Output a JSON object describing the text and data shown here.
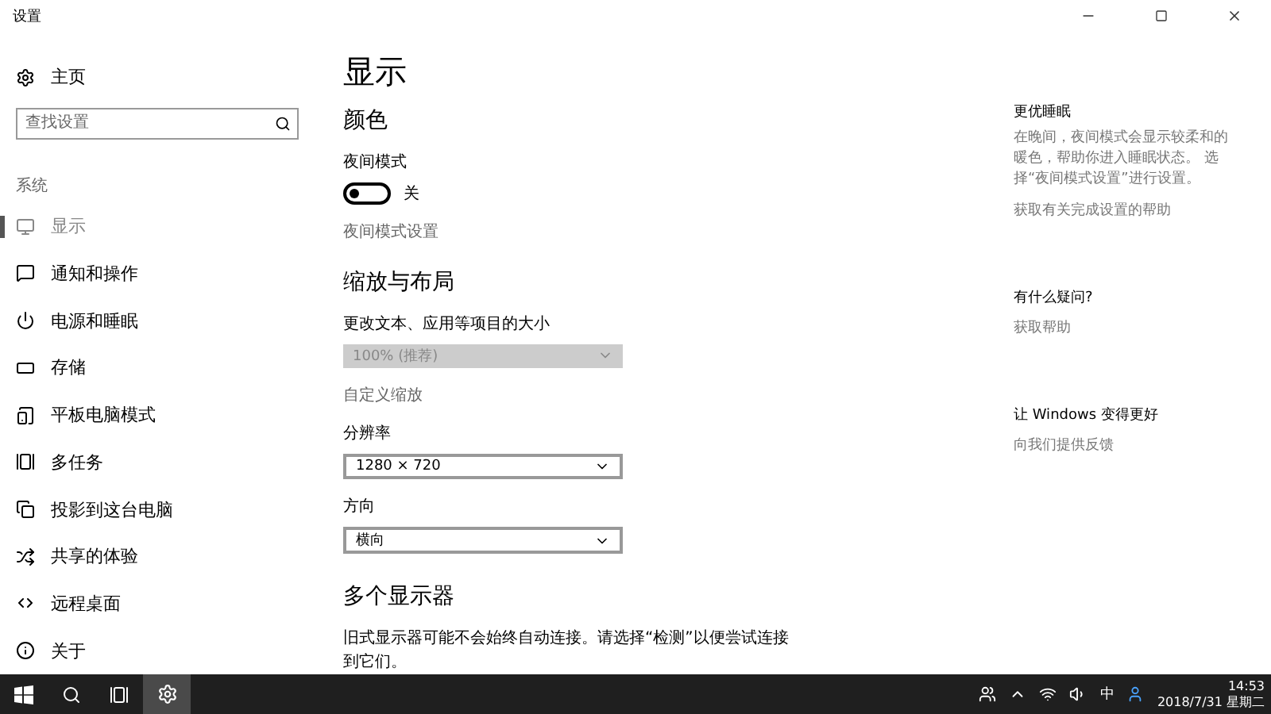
{
  "window": {
    "title": "设置"
  },
  "sidebar": {
    "home": "主页",
    "search": {
      "placeholder": "查找设置"
    },
    "section": "系统",
    "items": [
      {
        "label": "显示",
        "selected": true
      },
      {
        "label": "通知和操作",
        "selected": false
      },
      {
        "label": "电源和睡眠",
        "selected": false
      },
      {
        "label": "存储",
        "selected": false
      },
      {
        "label": "平板电脑模式",
        "selected": false
      },
      {
        "label": "多任务",
        "selected": false
      },
      {
        "label": "投影到这台电脑",
        "selected": false
      },
      {
        "label": "共享的体验",
        "selected": false
      },
      {
        "label": "远程桌面",
        "selected": false
      },
      {
        "label": "关于",
        "selected": false
      }
    ]
  },
  "main": {
    "title": "显示",
    "color": {
      "heading": "颜色",
      "night_light": {
        "label": "夜间模式",
        "on": false,
        "state": "关"
      },
      "link": "夜间模式设置"
    },
    "scale": {
      "heading": "缩放与布局",
      "size_label": "更改文本、应用等项目的大小",
      "size_value": "100% (推荐)",
      "size_disabled": true,
      "custom_link": "自定义缩放",
      "resolution_label": "分辨率",
      "resolution_value": "1280 × 720",
      "orientation_label": "方向",
      "orientation_value": "横向"
    },
    "multi": {
      "heading": "多个显示器",
      "text": "旧式显示器可能不会始终自动连接。请选择“检测”以便尝试连接到它们。"
    }
  },
  "aside": [
    {
      "heading": "更优睡眠",
      "text": "在晚间，夜间模式会显示较柔和的暖色，帮助你进入睡眠状态。 选择“夜间模式设置”进行设置。",
      "link": "获取有关完成设置的帮助"
    },
    {
      "heading": "有什么疑问?",
      "link": "获取帮助"
    },
    {
      "heading": "让 Windows 变得更好",
      "link": "向我们提供反馈"
    }
  ],
  "taskbar": {
    "ime": "中",
    "time": "14:53",
    "date": "2018/7/31 星期二",
    "settings_active": true
  }
}
